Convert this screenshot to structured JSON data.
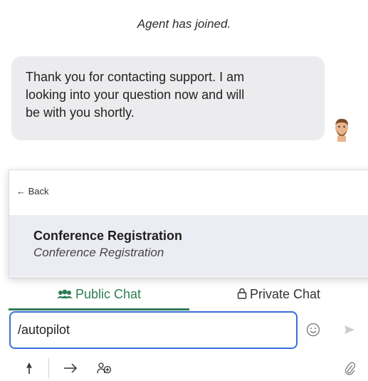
{
  "system_message": "Agent has joined.",
  "agent_message": {
    "lines": [
      "Thank you for contacting support. I am",
      "looking into your question now and will",
      "be with you shortly."
    ],
    "avatar_icon": "agent-avatar"
  },
  "panel": {
    "back_label": "← Back",
    "conversation": {
      "title": "Conference Registration",
      "subtitle": "Conference Registration"
    }
  },
  "tabs": {
    "public": {
      "label": "Public Chat",
      "icon": "group-icon",
      "active": true,
      "color": "#2e7d55"
    },
    "private": {
      "label": "Private Chat",
      "icon": "lock-icon",
      "active": false
    }
  },
  "composer": {
    "value": "/autopilot",
    "focus_color": "#3a6fd8",
    "emoji_icon": "smiley-icon",
    "send_icon": "send-icon"
  },
  "toolbar": {
    "icons": [
      "pin-icon",
      "forward-arrow-icon",
      "team-add-icon",
      "paperclip-icon"
    ]
  }
}
